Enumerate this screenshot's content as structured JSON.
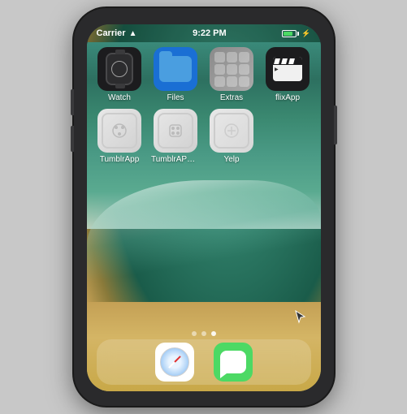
{
  "statusBar": {
    "carrier": "Carrier",
    "time": "9:22 PM",
    "battery_percent": 80
  },
  "apps": {
    "row1": [
      {
        "id": "watch",
        "label": "Watch"
      },
      {
        "id": "files",
        "label": "Files"
      },
      {
        "id": "extras",
        "label": "Extras"
      },
      {
        "id": "flix",
        "label": "flixApp"
      }
    ],
    "row2": [
      {
        "id": "tumblr",
        "label": "TumblrApp"
      },
      {
        "id": "tumblrapp2",
        "label": "TumblrAPP_E..."
      },
      {
        "id": "yelp",
        "label": "Yelp"
      }
    ]
  },
  "pageDots": [
    {
      "active": false
    },
    {
      "active": false
    },
    {
      "active": true
    }
  ],
  "dock": {
    "apps": [
      {
        "id": "safari",
        "label": "Safari"
      },
      {
        "id": "messages",
        "label": "Messages"
      }
    ]
  }
}
